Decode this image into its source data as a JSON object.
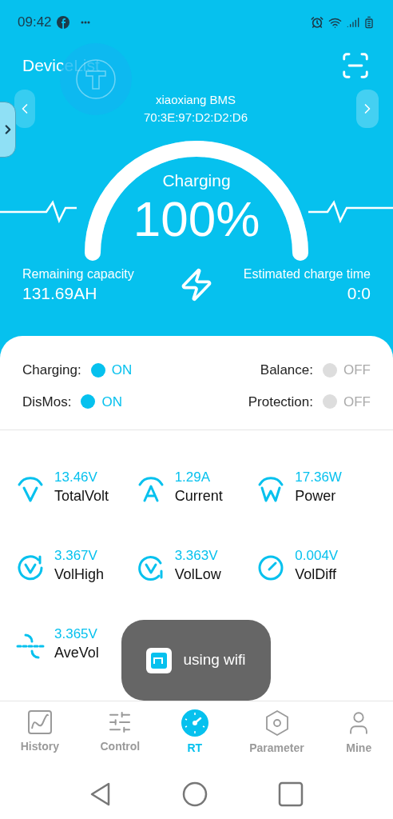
{
  "status_bar": {
    "time": "09:42"
  },
  "header": {
    "title": "DeviceList",
    "device_name": "xiaoxiang BMS",
    "mac": "70:3E:97:D2:D2:D6"
  },
  "gauge": {
    "status": "Charging",
    "percent": "100%",
    "level": 1
  },
  "capacity": {
    "label": "Remaining capacity",
    "value": "131.69AH"
  },
  "charge_time": {
    "label": "Estimated charge time",
    "value": "0:0"
  },
  "switches": [
    {
      "label": "Charging:",
      "state": "ON",
      "on": true
    },
    {
      "label": "Balance:",
      "state": "OFF",
      "on": false
    },
    {
      "label": "DisMos:",
      "state": "ON",
      "on": true
    },
    {
      "label": "Protection:",
      "state": "OFF",
      "on": false
    }
  ],
  "metrics": [
    {
      "kind": "volt",
      "value": "13.46V",
      "label": "TotalVolt"
    },
    {
      "kind": "amp",
      "value": "1.29A",
      "label": "Current"
    },
    {
      "kind": "watt",
      "value": "17.36W",
      "label": "Power"
    },
    {
      "kind": "high",
      "value": "3.367V",
      "label": "VolHigh"
    },
    {
      "kind": "low",
      "value": "3.363V",
      "label": "VolLow"
    },
    {
      "kind": "diff",
      "value": "0.004V",
      "label": "VolDiff"
    },
    {
      "kind": "ave",
      "value": "3.365V",
      "label": "AveVol"
    }
  ],
  "toast": {
    "text": "using wifi"
  },
  "tabs": [
    {
      "label": "History",
      "kind": "history",
      "selected": false
    },
    {
      "label": "Control",
      "kind": "control",
      "selected": false
    },
    {
      "label": "RT",
      "kind": "rt",
      "selected": true
    },
    {
      "label": "Parameter",
      "kind": "parameter",
      "selected": false
    },
    {
      "label": "Mine",
      "kind": "mine",
      "selected": false
    }
  ]
}
